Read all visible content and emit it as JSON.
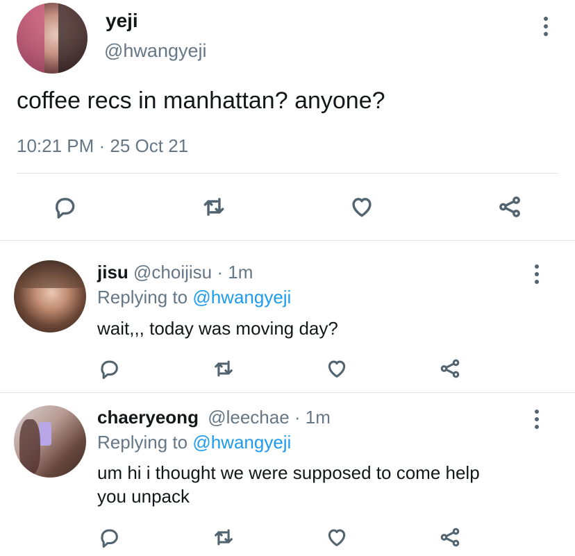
{
  "main_tweet": {
    "display_name": "yeji",
    "handle": "@hwangyeji",
    "text": "coffee recs in manhattan? anyone?",
    "timestamp": "10:21 PM · 25 Oct 21"
  },
  "replies": [
    {
      "display_name": "jisu",
      "handle": "@choijisu",
      "time": "· 1m",
      "replying_prefix": "Replying to",
      "replying_handle": "@hwangyeji",
      "text": "wait,,, today was moving day?"
    },
    {
      "display_name": "chaeryeong",
      "handle": "@leechae",
      "time": "· 1m",
      "replying_prefix": "Replying to",
      "replying_handle": "@hwangyeji",
      "text_line1": "um hi i thought we were supposed to come help",
      "text_line2": "you unpack"
    }
  ],
  "icons": [
    "reply-icon",
    "retweet-icon",
    "like-icon",
    "share-icon",
    "more-options-icon"
  ],
  "colors": {
    "link": "#1d9bf0",
    "muted": "#657786",
    "icon": "#536471",
    "divider": "#e1e5ea"
  }
}
